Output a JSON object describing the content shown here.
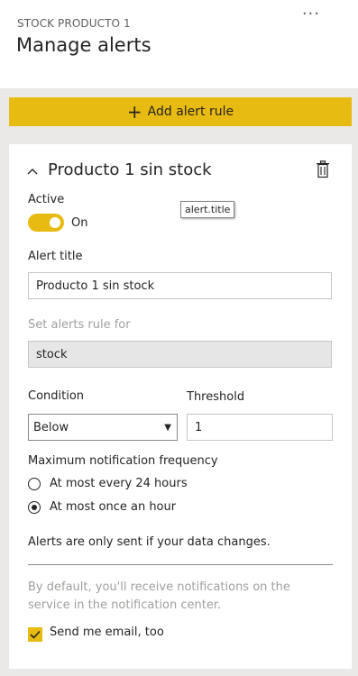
{
  "header": {
    "subtitle": "STOCK PRODUCTO 1",
    "title": "Manage alerts",
    "more_label": "..."
  },
  "add_rule_label": "Add alert rule",
  "rule": {
    "title": "Producto 1 sin stock",
    "active_label": "Active",
    "toggle_value": "On",
    "tooltip": "alert.title",
    "alert_title_label": "Alert title",
    "alert_title_value": "Producto 1 sin stock",
    "set_rule_label": "Set alerts rule for",
    "set_rule_value": "stock",
    "condition_label": "Condition",
    "condition_value": "Below",
    "threshold_label": "Threshold",
    "threshold_value": "1",
    "frequency_label": "Maximum notification frequency",
    "frequency_options": [
      "At most every 24 hours",
      "At most once an hour"
    ],
    "frequency_selected": 1,
    "data_change_note": "Alerts are only sent if your data changes.",
    "default_note": "By default, you'll receive notifications on the service in the notification center.",
    "email_label": "Send me email, too",
    "email_checked": true
  },
  "colors": {
    "accent": "#e8bb12",
    "panel_bg": "#eae9e8",
    "muted_text": "#a19f9d"
  }
}
